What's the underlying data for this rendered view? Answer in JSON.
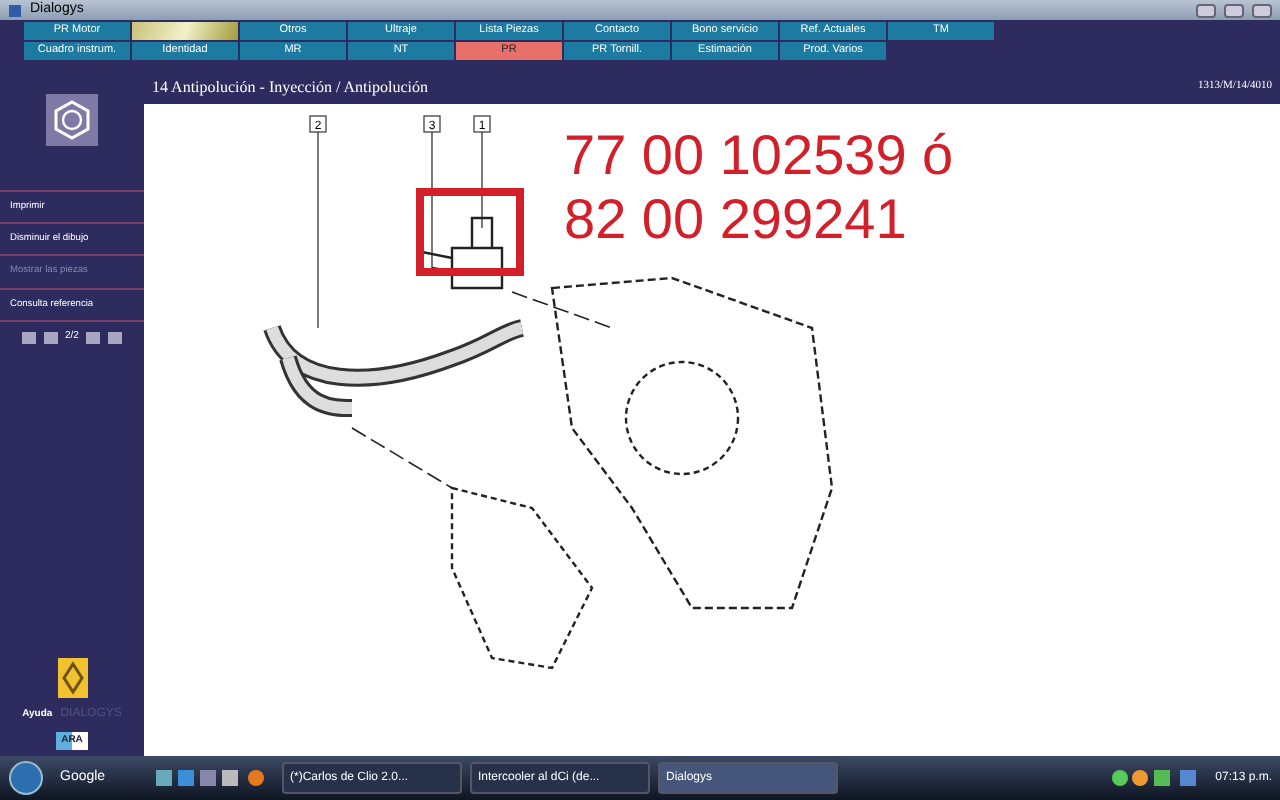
{
  "window": {
    "title": "Dialogys"
  },
  "tabs": [
    [
      {
        "label": "PR Motor",
        "kind": "text",
        "selected": false
      },
      {
        "kind": "image",
        "selected": false
      },
      {
        "label": "Otros",
        "kind": "text",
        "selected": false
      },
      {
        "label": "Ultraje",
        "kind": "text",
        "selected": false
      },
      {
        "label": "Lista Piezas",
        "kind": "text",
        "selected": false
      },
      {
        "label": "Contacto",
        "kind": "text",
        "selected": false
      },
      {
        "label": "Bono servicio",
        "kind": "text",
        "selected": false
      },
      {
        "label": "Ref. Actuales",
        "kind": "text",
        "selected": false
      },
      {
        "label": "TM",
        "kind": "text",
        "selected": false
      }
    ],
    [
      {
        "label": "Cuadro instrum.",
        "kind": "text",
        "selected": false
      },
      {
        "label": "Identidad",
        "kind": "text",
        "selected": false
      },
      {
        "label": "MR",
        "kind": "text",
        "selected": false
      },
      {
        "label": "NT",
        "kind": "text",
        "selected": false
      },
      {
        "label": "PR",
        "kind": "text",
        "selected": true
      },
      {
        "label": "PR Tornill.",
        "kind": "text",
        "selected": false
      },
      {
        "label": "Estimación",
        "kind": "text",
        "selected": false
      },
      {
        "label": "Prod. Varios",
        "kind": "text",
        "selected": false
      }
    ]
  ],
  "sidebar": {
    "items": [
      {
        "label": "Imprimir",
        "disabled": false
      },
      {
        "label": "Disminuir el dibujo",
        "disabled": false
      },
      {
        "label": "Mostrar las piezas",
        "disabled": true
      },
      {
        "label": "Consulta referencia",
        "disabled": false
      }
    ],
    "pager": "2/2",
    "help": "Ayuda",
    "brand": "DIALOGYS",
    "badge": "ARA"
  },
  "header": {
    "title": "14 Antipolución - Inyección / Antipolución",
    "reference": "1313/M/14/4010"
  },
  "drawing": {
    "callouts": [
      "2",
      "3",
      "1"
    ],
    "part_numbers": [
      "77 00 102539 ó",
      "82 00 299241"
    ]
  },
  "taskbar": {
    "search": "Google",
    "tasks": [
      {
        "label": "(*)Carlos de Clio 2.0...",
        "selected": false
      },
      {
        "label": "Intercooler al dCi (de...",
        "selected": false
      },
      {
        "label": "Dialogys",
        "selected": true
      }
    ],
    "clock": "07:13 p.m."
  }
}
